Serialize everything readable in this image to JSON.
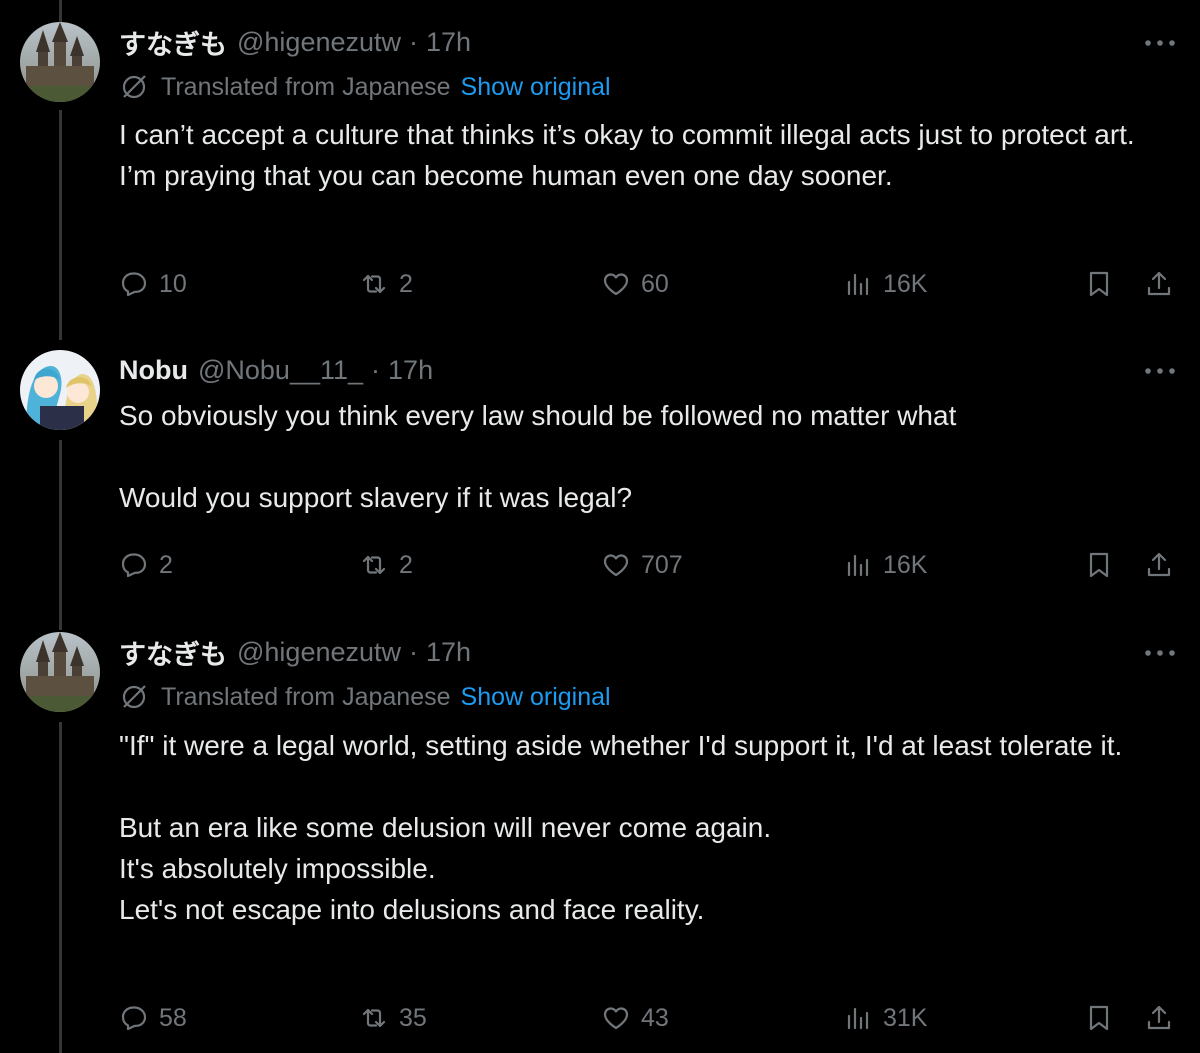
{
  "tweets": [
    {
      "name": "すなぎも",
      "handle": "@higenezutw",
      "time": "17h",
      "translated": true,
      "translated_label": "Translated from Japanese",
      "show_original": "Show original",
      "lines": [
        "I can’t accept a culture that thinks it’s okay to commit illegal acts just to protect art.",
        "I’m praying that you can become human even one day sooner."
      ],
      "replies": "10",
      "reposts": "2",
      "likes": "60",
      "views": "16K"
    },
    {
      "name": "Nobu",
      "handle": "@Nobu__11_",
      "time": "17h",
      "translated": false,
      "lines": [
        "So obviously you think every law should be followed no matter what",
        "",
        "Would you support slavery if it was legal?"
      ],
      "replies": "2",
      "reposts": "2",
      "likes": "707",
      "views": "16K"
    },
    {
      "name": "すなぎも",
      "handle": "@higenezutw",
      "time": "17h",
      "translated": true,
      "translated_label": "Translated from Japanese",
      "show_original": "Show original",
      "lines": [
        "\"If\" it were a legal world, setting aside whether I'd support it, I'd at least tolerate it.",
        "",
        "But an era like some delusion will never come again.",
        "It's absolutely impossible.",
        "Let's not escape into delusions and face reality."
      ],
      "replies": "58",
      "reposts": "35",
      "likes": "43",
      "views": "31K"
    }
  ],
  "icons": {
    "reply": "reply-icon",
    "repost": "repost-icon",
    "like": "heart-icon",
    "views": "analytics-icon",
    "bookmark": "bookmark-icon",
    "share": "share-icon",
    "more": "more-icon",
    "translate": "translate-icon"
  },
  "colors": {
    "background": "#000000",
    "text": "#e7e9ea",
    "muted": "#71767b",
    "link": "#1d9bf0"
  }
}
